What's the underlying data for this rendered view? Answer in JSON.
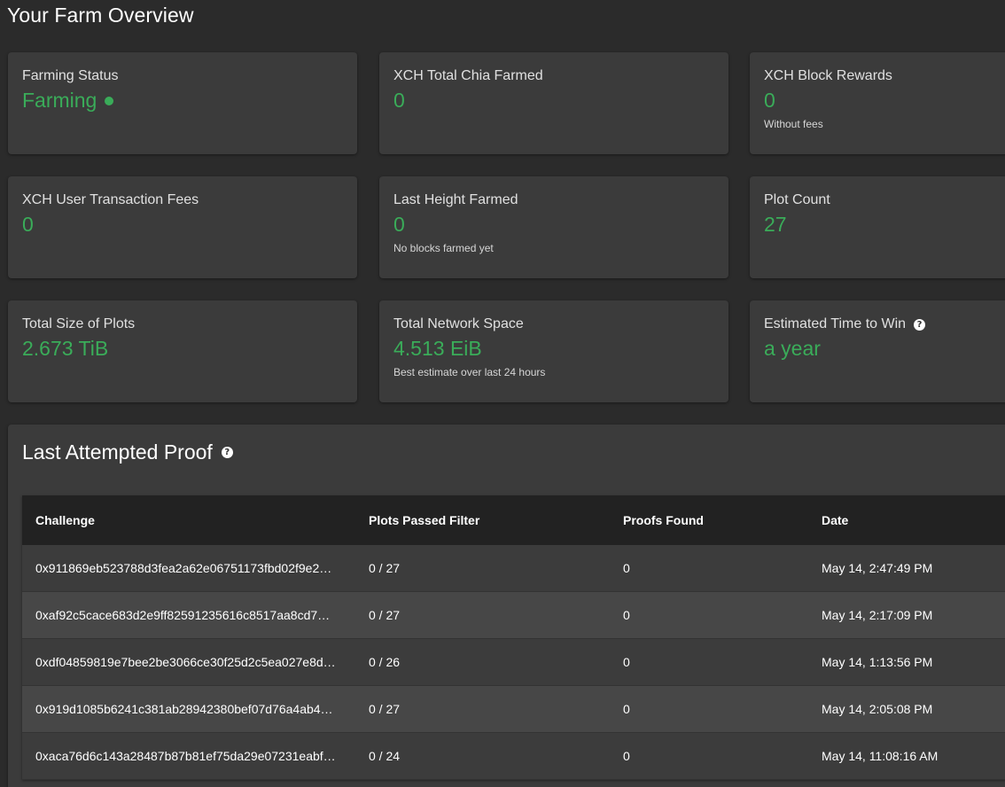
{
  "page_title": "Your Farm Overview",
  "cards": [
    {
      "label": "Farming Status",
      "value": "Farming",
      "note": ""
    },
    {
      "label": "XCH Total Chia Farmed",
      "value": "0",
      "note": ""
    },
    {
      "label": "XCH Block Rewards",
      "value": "0",
      "note": "Without fees"
    },
    {
      "label": "XCH User Transaction Fees",
      "value": "0",
      "note": ""
    },
    {
      "label": "Last Height Farmed",
      "value": "0",
      "note": "No blocks farmed yet"
    },
    {
      "label": "Plot Count",
      "value": "27",
      "note": ""
    },
    {
      "label": "Total Size of Plots",
      "value": "2.673 TiB",
      "note": ""
    },
    {
      "label": "Total Network Space",
      "value": "4.513 EiB",
      "note": "Best estimate over last 24 hours"
    },
    {
      "label": "Estimated Time to Win",
      "value": "a year",
      "note": ""
    }
  ],
  "colors": {
    "accent_green": "#3aac59",
    "card_bg": "#3b3b3b",
    "page_bg": "#2b2b2b",
    "table_header_bg": "#222222"
  },
  "icons": {
    "status": "status-dot-icon",
    "help": "help-circle-icon"
  },
  "proof": {
    "title": "Last Attempted Proof",
    "columns": [
      "Challenge",
      "Plots Passed Filter",
      "Proofs Found",
      "Date"
    ],
    "rows": [
      {
        "challenge": "0x911869eb523788d3fea2a62e06751173fbd02f9e2…",
        "plots": "0 / 27",
        "proofs": "0",
        "date": "May 14, 2:47:49 PM"
      },
      {
        "challenge": "0xaf92c5cace683d2e9ff82591235616c8517aa8cd7…",
        "plots": "0 / 27",
        "proofs": "0",
        "date": "May 14, 2:17:09 PM"
      },
      {
        "challenge": "0xdf04859819e7bee2be3066ce30f25d2c5ea027e8d…",
        "plots": "0 / 26",
        "proofs": "0",
        "date": "May 14, 1:13:56 PM"
      },
      {
        "challenge": "0x919d1085b6241c381ab28942380bef07d76a4ab4…",
        "plots": "0 / 27",
        "proofs": "0",
        "date": "May 14, 2:05:08 PM"
      },
      {
        "challenge": "0xaca76d6c143a28487b87b81ef75da29e07231eabf…",
        "plots": "0 / 24",
        "proofs": "0",
        "date": "May 14, 11:08:16 AM"
      }
    ]
  }
}
